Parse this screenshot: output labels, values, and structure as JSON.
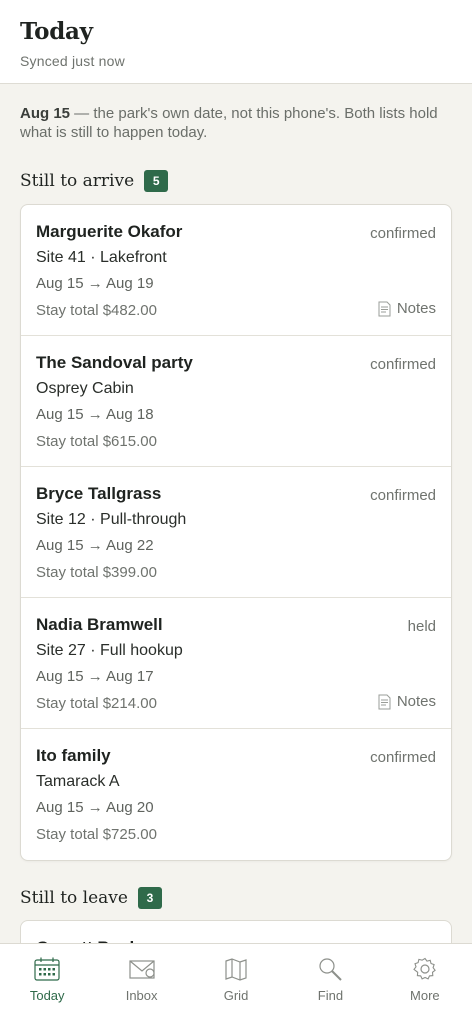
{
  "header": {
    "title": "Today",
    "sync_status": "Synced just now"
  },
  "note": {
    "date": "Aug 15",
    "text": " — the park's own date, not this phone's. Both lists hold what is still to happen today."
  },
  "arrivals": {
    "title": "Still to arrive",
    "count": "5",
    "items": [
      {
        "name": "Marguerite Okafor",
        "status": "confirmed",
        "site": "Site 41 · Lakefront",
        "dates": "Aug 15 → Aug 19",
        "total": "Stay total $482.00",
        "notes": "Notes"
      },
      {
        "name": "The Sandoval party",
        "status": "confirmed",
        "site": "Osprey Cabin",
        "dates": "Aug 15 → Aug 18",
        "total": "Stay total $615.00"
      },
      {
        "name": "Bryce Tallgrass",
        "status": "confirmed",
        "site": "Site 12 · Pull-through",
        "dates": "Aug 15 → Aug 22",
        "total": "Stay total $399.00"
      },
      {
        "name": "Nadia Bramwell",
        "status": "held",
        "site": "Site 27 · Full hookup",
        "dates": "Aug 15 → Aug 17",
        "total": "Stay total $214.00",
        "notes": "Notes"
      },
      {
        "name": "Ito family",
        "status": "confirmed",
        "site": "Tamarack A",
        "dates": "Aug 15 → Aug 20",
        "total": "Stay total $725.00"
      }
    ]
  },
  "departures": {
    "title": "Still to leave",
    "count": "3",
    "first_name": "Garrett Bush"
  },
  "tabbar": {
    "active_color": "#2f6a4a",
    "tabs": [
      {
        "label": "Today",
        "icon": "calendar-icon"
      },
      {
        "label": "Inbox",
        "icon": "envelope-icon"
      },
      {
        "label": "Grid",
        "icon": "map-icon"
      },
      {
        "label": "Find",
        "icon": "search-icon"
      },
      {
        "label": "More",
        "icon": "gear-icon"
      }
    ]
  }
}
